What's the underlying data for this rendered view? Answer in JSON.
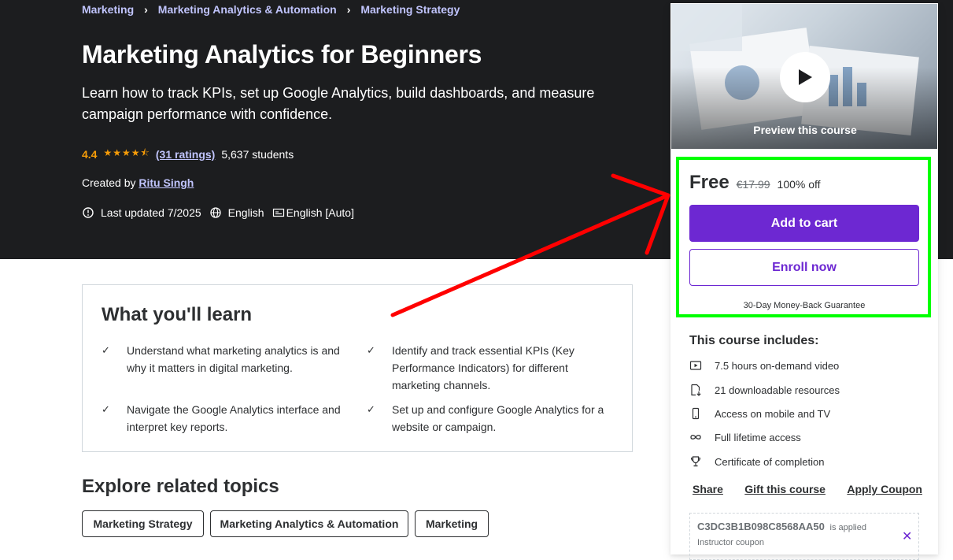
{
  "breadcrumb": {
    "items": [
      "Marketing",
      "Marketing Analytics & Automation",
      "Marketing Strategy"
    ],
    "separator": "›"
  },
  "course": {
    "title": "Marketing Analytics for Beginners",
    "subtitle": "Learn how to track KPIs, set up Google Analytics, build dashboards, and measure campaign performance with confidence.",
    "rating": "4.4",
    "stars": "★★★★⯪",
    "ratings_link": "(31 ratings)",
    "students": "5,637 students",
    "created_by_label": "Created by",
    "instructor": "Ritu Singh",
    "last_updated": "Last updated 7/2025",
    "language": "English",
    "captions": "English [Auto]"
  },
  "learn": {
    "title": "What you'll learn",
    "items": [
      "Understand what marketing analytics is and why it matters in digital marketing.",
      "Identify and track essential KPIs (Key Performance Indicators) for different marketing channels.",
      "Navigate the Google Analytics interface and interpret key reports.",
      "Set up and configure Google Analytics for a website or campaign."
    ]
  },
  "related": {
    "title": "Explore related topics",
    "topics": [
      "Marketing Strategy",
      "Marketing Analytics & Automation",
      "Marketing"
    ]
  },
  "sidebar": {
    "preview_label": "Preview this course",
    "price": "Free",
    "original_price": "€17.99",
    "discount": "100% off",
    "add_to_cart": "Add to cart",
    "enroll_now": "Enroll now",
    "guarantee": "30-Day Money-Back Guarantee",
    "includes_title": "This course includes:",
    "includes": [
      {
        "icon": "video-icon",
        "text": "7.5 hours on-demand video"
      },
      {
        "icon": "download-file-icon",
        "text": "21 downloadable resources"
      },
      {
        "icon": "mobile-icon",
        "text": "Access on mobile and TV"
      },
      {
        "icon": "infinity-icon",
        "text": "Full lifetime access"
      },
      {
        "icon": "trophy-icon",
        "text": "Certificate of completion"
      }
    ],
    "share": "Share",
    "gift": "Gift this course",
    "apply_coupon": "Apply Coupon",
    "coupon_code": "C3DC3B1B098C8568AA50",
    "coupon_applied": "is applied",
    "coupon_sub": "Instructor coupon"
  },
  "colors": {
    "hero_bg": "#1c1d1f",
    "accent_purple": "#6d28d2",
    "link_lavender": "#c0c4fc",
    "star_orange": "#f69c08",
    "annotation_green": "#00ff00",
    "annotation_red": "#ff0000"
  }
}
